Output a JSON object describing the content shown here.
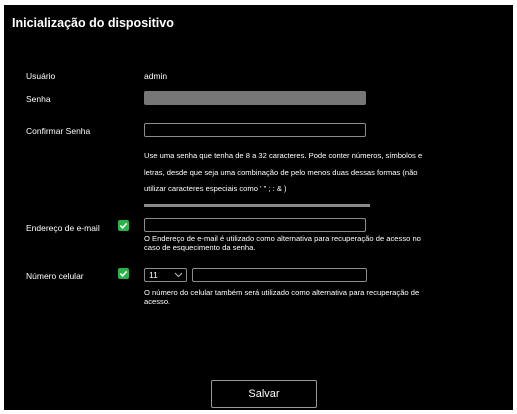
{
  "dialog": {
    "title": "Inicialização do dispositivo"
  },
  "user": {
    "label": "Usuário",
    "value": "admin"
  },
  "password": {
    "label": "Senha",
    "value": ""
  },
  "confirm_password": {
    "label": "Confirmar Senha",
    "value": "",
    "help_line1": "Use uma senha que tenha de 8 a 32 caracteres. Pode conter números, símbolos e",
    "help_line2": "letras, desde que seja uma combinação de pelo menos duas dessas formas (não",
    "help_line3": "utilizar caracteres especiais como ' \" ; : & )"
  },
  "email": {
    "label": "Endereço de e-mail",
    "checked": true,
    "value": "",
    "help_line1": "O Endereço de e-mail é utilizado como alternativa para recuperação de acesso no",
    "help_line2": "caso de esquecimento da senha."
  },
  "phone": {
    "label": "Número celular",
    "checked": true,
    "country_code": "11",
    "value": "",
    "help_line1": "O número do celular também será utilizado como alternativa para recuperação de",
    "help_line2": "acesso."
  },
  "actions": {
    "save_label": "Salvar"
  },
  "colors": {
    "background": "#000000",
    "checkbox": "#2bb34a",
    "border": "#8c8c8c",
    "filled_input": "#767676"
  },
  "icons": {
    "checkbox": "check-icon",
    "select": "chevron-down-icon"
  }
}
